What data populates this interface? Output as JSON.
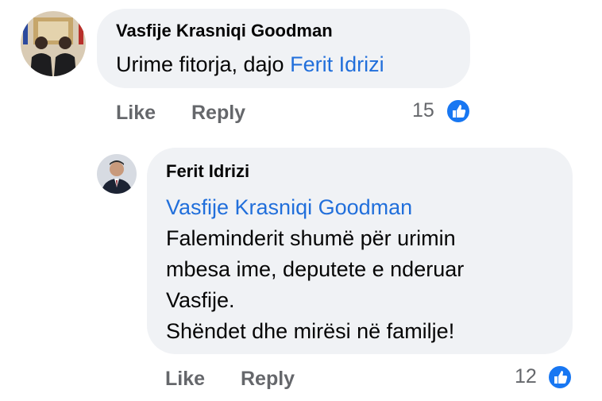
{
  "comment": {
    "author": "Vasfije Krasniqi Goodman",
    "text": "Urime fitorja, dajo ",
    "mention": "Ferit Idrizi",
    "actions": {
      "like": "Like",
      "reply": "Reply"
    },
    "reaction_count": "15",
    "reaction_icon": "like-icon"
  },
  "reply": {
    "author": "Ferit Idrizi",
    "mention": "Vasfije Krasniqi Goodman",
    "lines": [
      "Faleminderit shumë për urimin",
      "mbesa ime, deputete e nderuar",
      "Vasfije.",
      "Shëndet dhe mirësi në familje!"
    ],
    "actions": {
      "like": "Like",
      "reply": "Reply"
    },
    "reaction_count": "12",
    "reaction_icon": "like-icon"
  },
  "colors": {
    "link": "#216fdb",
    "bubble": "#f0f2f5",
    "muted": "#65676b",
    "like": "#1877f2"
  }
}
